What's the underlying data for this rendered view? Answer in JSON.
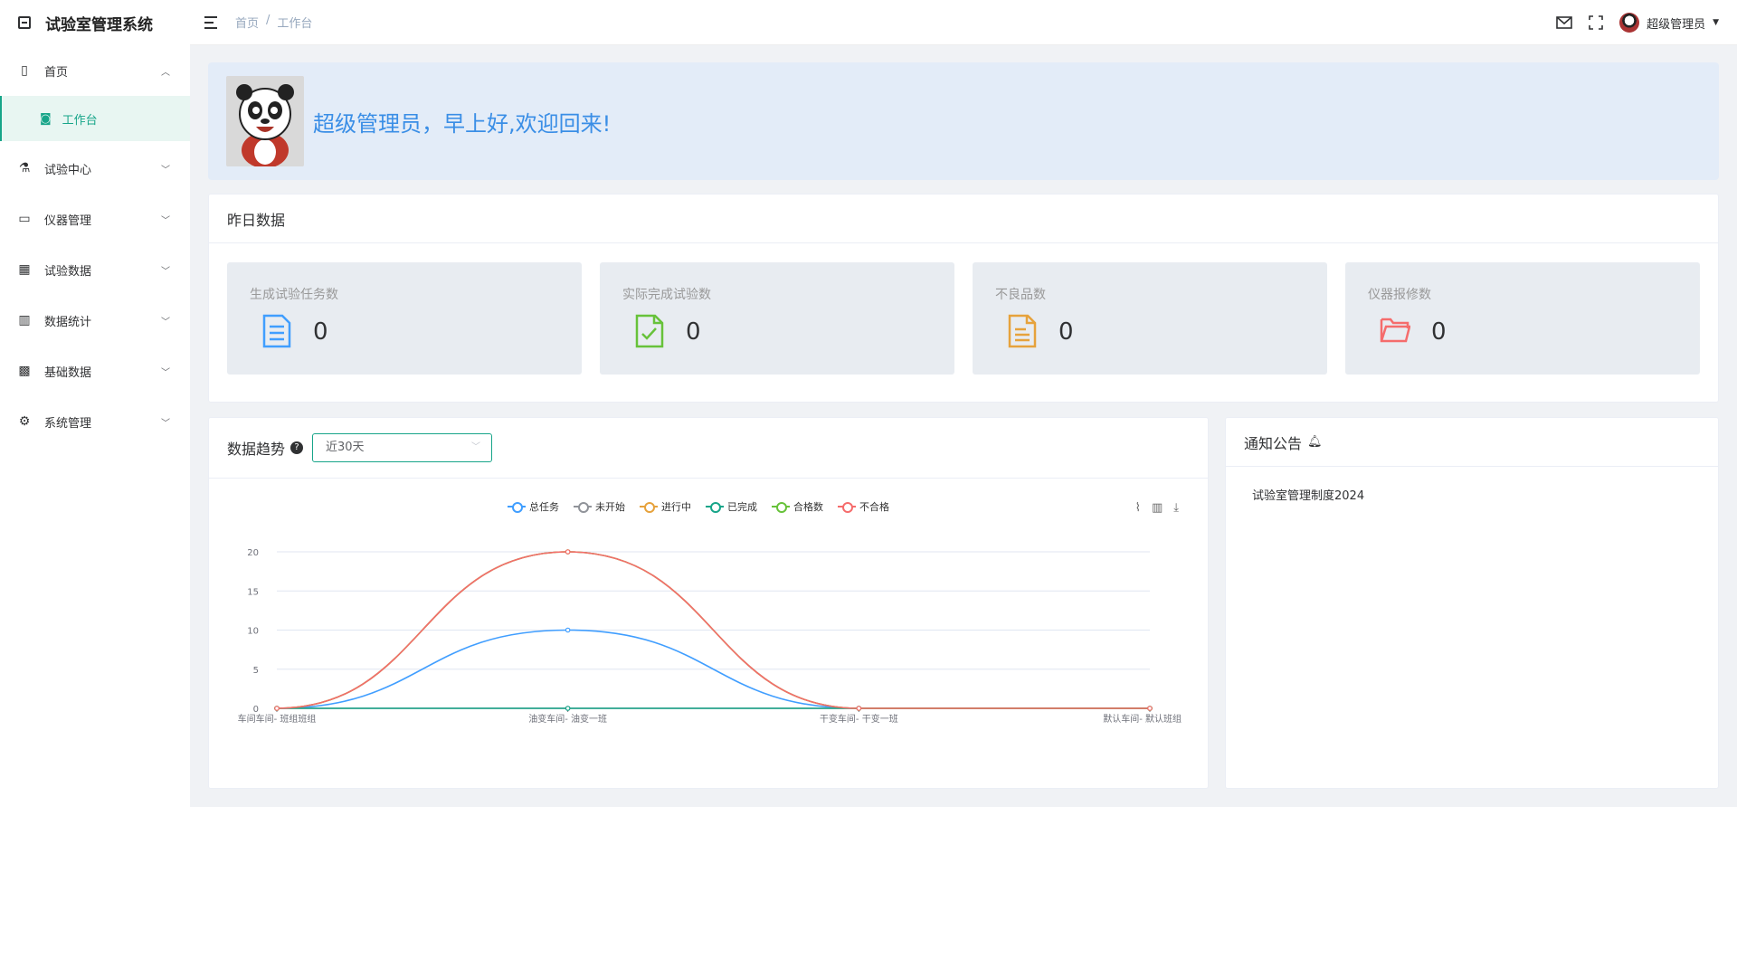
{
  "app": {
    "title": "试验室管理系统"
  },
  "sidebar": {
    "home": {
      "label": "首页"
    },
    "workbench": {
      "label": "工作台"
    },
    "items": [
      {
        "label": "试验中心",
        "icon": "flask-icon"
      },
      {
        "label": "仪器管理",
        "icon": "monitor-icon"
      },
      {
        "label": "试验数据",
        "icon": "grid-icon"
      },
      {
        "label": "数据统计",
        "icon": "bar-chart-icon"
      },
      {
        "label": "基础数据",
        "icon": "apps-icon"
      },
      {
        "label": "系统管理",
        "icon": "gear-icon"
      }
    ]
  },
  "header": {
    "breadcrumb": [
      "首页",
      "工作台"
    ],
    "user": "超级管理员"
  },
  "welcome": {
    "text": "超级管理员，早上好,欢迎回来!"
  },
  "yesterday": {
    "title": "昨日数据",
    "stats": [
      {
        "label": "生成试验任务数",
        "value": "0",
        "color": "#409eff"
      },
      {
        "label": "实际完成试验数",
        "value": "0",
        "color": "#67c23a"
      },
      {
        "label": "不良品数",
        "value": "0",
        "color": "#e6a23c"
      },
      {
        "label": "仪器报修数",
        "value": "0",
        "color": "#f56c6c"
      }
    ]
  },
  "trend": {
    "title": "数据趋势",
    "range": "近30天"
  },
  "notice": {
    "title": "通知公告",
    "items": [
      "试验室管理制度2024"
    ]
  },
  "chart_data": {
    "type": "line",
    "categories": [
      "车间车间- 班组班组",
      "油变车间- 油变一班",
      "干变车间- 干变一班",
      "默认车间- 默认班组"
    ],
    "series": [
      {
        "name": "总任务",
        "values": [
          0,
          10,
          0,
          0
        ],
        "color": "#409eff"
      },
      {
        "name": "未开始",
        "values": [
          0,
          0,
          0,
          0
        ],
        "color": "#909399"
      },
      {
        "name": "进行中",
        "values": [
          0,
          20,
          0,
          0
        ],
        "color": "#e6a23c"
      },
      {
        "name": "已完成",
        "values": [
          0,
          0,
          0,
          0
        ],
        "color": "#17a589"
      },
      {
        "name": "合格数",
        "values": [
          0,
          20,
          0,
          0
        ],
        "color": "#67c23a"
      },
      {
        "name": "不合格",
        "values": [
          0,
          20,
          0,
          0
        ],
        "color": "#f56c6c"
      }
    ],
    "ylim": [
      0,
      20
    ],
    "yticks": [
      0,
      5,
      10,
      15,
      20
    ],
    "smooth": true
  }
}
